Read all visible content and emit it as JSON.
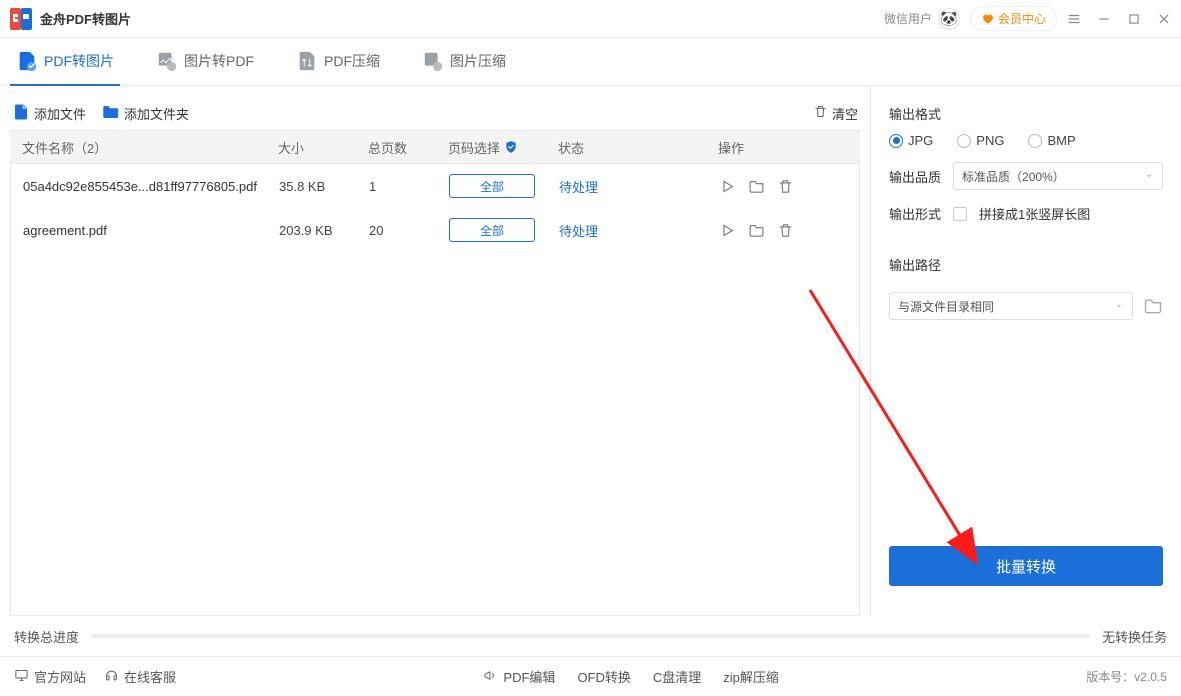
{
  "titlebar": {
    "app_title": "金舟PDF转图片",
    "wx_user_label": "微信用户",
    "vip_label": "会员中心"
  },
  "tabs": [
    {
      "label": "PDF转图片",
      "active": true
    },
    {
      "label": "图片转PDF",
      "active": false
    },
    {
      "label": "PDF压缩",
      "active": false
    },
    {
      "label": "图片压缩",
      "active": false
    }
  ],
  "toolbar": {
    "add_file": "添加文件",
    "add_folder": "添加文件夹",
    "clear": "清空"
  },
  "table": {
    "headers": {
      "name": "文件名称（2）",
      "size": "大小",
      "pages": "总页数",
      "page_select": "页码选择",
      "status": "状态",
      "ops": "操作"
    },
    "select_all_label": "全部",
    "rows": [
      {
        "name": "05a4dc92e855453e...d81ff97776805.pdf",
        "size": "35.8 KB",
        "pages": "1",
        "status": "待处理"
      },
      {
        "name": "agreement.pdf",
        "size": "203.9 KB",
        "pages": "20",
        "status": "待处理"
      }
    ]
  },
  "progress": {
    "label": "转换总进度",
    "status": "无转换任务"
  },
  "sidebar": {
    "format_label": "输出格式",
    "format_options": [
      {
        "label": "JPG",
        "selected": true
      },
      {
        "label": "PNG",
        "selected": false
      },
      {
        "label": "BMP",
        "selected": false
      }
    ],
    "quality_label": "输出品质",
    "quality_value": "标准品质（200%）",
    "mode_label": "输出形式",
    "mode_checkbox_label": "拼接成1张竖屏长图",
    "path_label": "输出路径",
    "path_value": "与源文件目录相同",
    "convert_btn": "批量转换"
  },
  "bottombar": {
    "site": "官方网站",
    "support": "在线客服",
    "links": [
      "PDF编辑",
      "OFD转换",
      "C盘清理",
      "zip解压缩"
    ],
    "version_label": "版本号：v2.0.5"
  }
}
